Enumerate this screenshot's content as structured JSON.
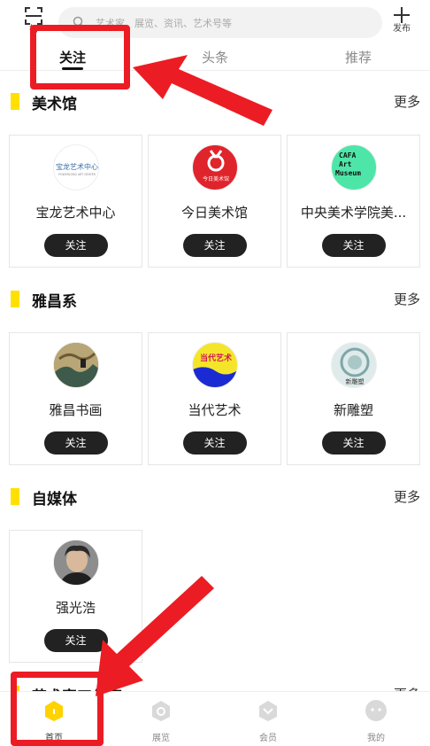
{
  "header": {
    "scan_label": "扫",
    "search_placeholder": "艺术家、展览、资讯、艺术号等",
    "publish_label": "发布"
  },
  "tabs": [
    {
      "label": "关注",
      "active": true
    },
    {
      "label": "头条",
      "active": false
    },
    {
      "label": "推荐",
      "active": false
    }
  ],
  "sections": [
    {
      "title": "美术馆",
      "more": "更多",
      "cards": [
        {
          "name": "宝龙艺术中心",
          "follow": "关注"
        },
        {
          "name": "今日美术馆",
          "follow": "关注"
        },
        {
          "name": "中央美术学院美...",
          "follow": "关注"
        }
      ]
    },
    {
      "title": "雅昌系",
      "more": "更多",
      "cards": [
        {
          "name": "雅昌书画",
          "follow": "关注"
        },
        {
          "name": "当代艺术",
          "follow": "关注"
        },
        {
          "name": "新雕塑",
          "follow": "关注"
        }
      ]
    },
    {
      "title": "自媒体",
      "more": "更多",
      "cards": [
        {
          "name": "强光浩",
          "follow": "关注"
        }
      ]
    },
    {
      "title": "艺术家工作室",
      "more": "更多"
    }
  ],
  "logos": {
    "powerlong_text": "宝龙艺术中心",
    "powerlong_sub": "POWERLONG ART CENTER",
    "today_text": "今日美术馆",
    "cafa_lines": [
      "CAFA",
      "Art",
      "Museum"
    ],
    "contemporary_text": "当代艺术",
    "sculpture_text": "新雕塑"
  },
  "bottom_nav": [
    {
      "label": "首页",
      "icon": "home-icon",
      "active": true
    },
    {
      "label": "展览",
      "icon": "exhibition-icon",
      "active": false
    },
    {
      "label": "会员",
      "icon": "member-icon",
      "active": false
    },
    {
      "label": "我的",
      "icon": "profile-icon",
      "active": false
    }
  ],
  "colors": {
    "accent_yellow": "#ffe000",
    "annotation_red": "#ec1c24",
    "button_dark": "#222222"
  }
}
